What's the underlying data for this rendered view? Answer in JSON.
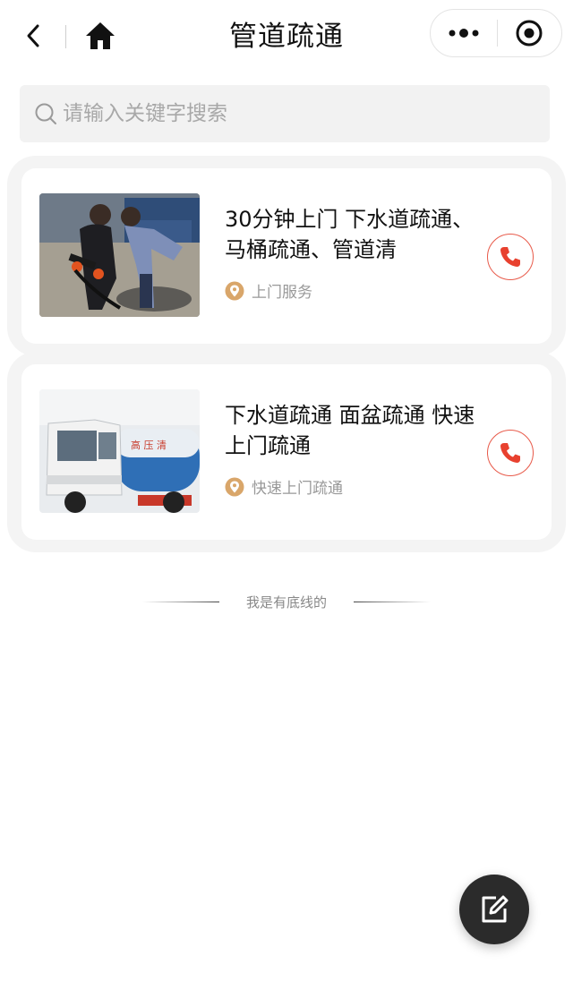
{
  "nav": {
    "title": "管道疏通",
    "back_icon": "chevron-left-icon",
    "home_icon": "home-icon",
    "more_icon": "more-dots-icon",
    "close_icon": "target-icon"
  },
  "search": {
    "placeholder": "请输入关键字搜索",
    "value": ""
  },
  "listings": [
    {
      "title": "30分钟上门 下水道疏通、马桶疏通、管道清",
      "tag": "上门服务",
      "image": "workers-clearing-drain-photo",
      "action_icon": "phone-icon"
    },
    {
      "title": "下水道疏通 面盆疏通 快速上门疏通",
      "tag": "快速上门疏通",
      "image": "sewer-truck-photo",
      "action_icon": "phone-icon"
    }
  ],
  "footer": {
    "end_text": "我是有底线的"
  },
  "fab": {
    "icon": "edit-icon"
  },
  "colors": {
    "accent": "#e8412f",
    "tag_icon": "#d9a66a",
    "fab_bg": "#2b2b2b",
    "search_bg": "#f2f2f2"
  }
}
